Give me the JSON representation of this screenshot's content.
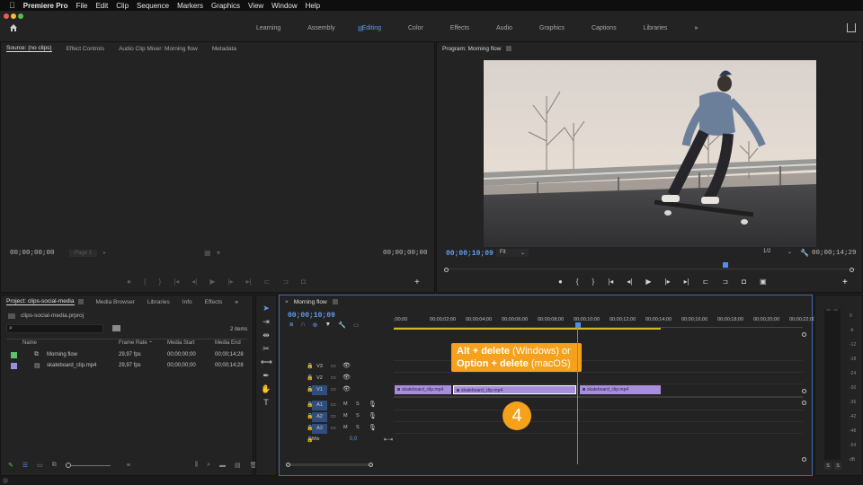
{
  "menubar": {
    "apple": "",
    "app": "Premiere Pro",
    "items": [
      "File",
      "Edit",
      "Clip",
      "Sequence",
      "Markers",
      "Graphics",
      "View",
      "Window",
      "Help"
    ]
  },
  "workspaces": {
    "items": [
      "Learning",
      "Assembly",
      "Editing",
      "Color",
      "Effects",
      "Audio",
      "Graphics",
      "Captions",
      "Libraries"
    ],
    "active": "Editing",
    "more": "»"
  },
  "source": {
    "tabs": [
      "Source: (no clips)",
      "Effect Controls",
      "Audio Clip Mixer: Morning flow",
      "Metadata"
    ],
    "tc_left": "00;00;00;00",
    "page": "Page 1",
    "tc_right": "00;00;00;00"
  },
  "program": {
    "tab": "Program: Morning flow",
    "tc_current": "00;00;10;09",
    "fit": "Fit",
    "res": "1/2",
    "tc_duration": "00;00;14;29"
  },
  "project": {
    "tabs": [
      "Project: clips-social-media",
      "Media Browser",
      "Libraries",
      "Info",
      "Effects"
    ],
    "file": "clips-social-media.prproj",
    "count": "2 items",
    "columns": [
      "Name",
      "Frame Rate",
      "Media Start",
      "Media End"
    ],
    "rows": [
      {
        "name": "Morning flow",
        "rate": "29,97 fps",
        "start": "00;00;00;00",
        "end": "00;00;14;28",
        "color": "#5bc46a"
      },
      {
        "name": "skateboard_clip.mp4",
        "rate": "29,97 fps",
        "start": "00;00;00;00",
        "end": "00;00;14;28",
        "color": "#9b8ce0"
      }
    ]
  },
  "timeline": {
    "tab": "Morning flow",
    "tc": "00;00;10;09",
    "ruler": [
      ";00;00",
      "00;00;02;00",
      "00;00;04;00",
      "00;00;06;00",
      "00;00;08;00",
      "00;00;10;00",
      "00;00;12;00",
      "00;00;14;00",
      "00;00;16;00",
      "00;00;18;00",
      "00;00;20;00",
      "00;00;22;00"
    ],
    "video_tracks": [
      "V3",
      "V2",
      "V1"
    ],
    "audio_tracks": [
      "A1",
      "A2",
      "A3"
    ],
    "mix_label": "Mix",
    "mix_value": "0,0",
    "clip_name": "skateboard_clip.mp4"
  },
  "callout": {
    "line1_bold": "Alt + delete",
    "line1_rest": " (Windows) or",
    "line2_bold": "Option + delete",
    "line2_rest": " (macOS)",
    "step": "4",
    "color": "#f5a11c"
  },
  "meter": {
    "scale": [
      "0",
      "-6",
      "-12",
      "-18",
      "-24",
      "-30",
      "-36",
      "-42",
      "-48",
      "-54",
      "dB"
    ],
    "solo_left": "S",
    "solo_right": "S"
  }
}
